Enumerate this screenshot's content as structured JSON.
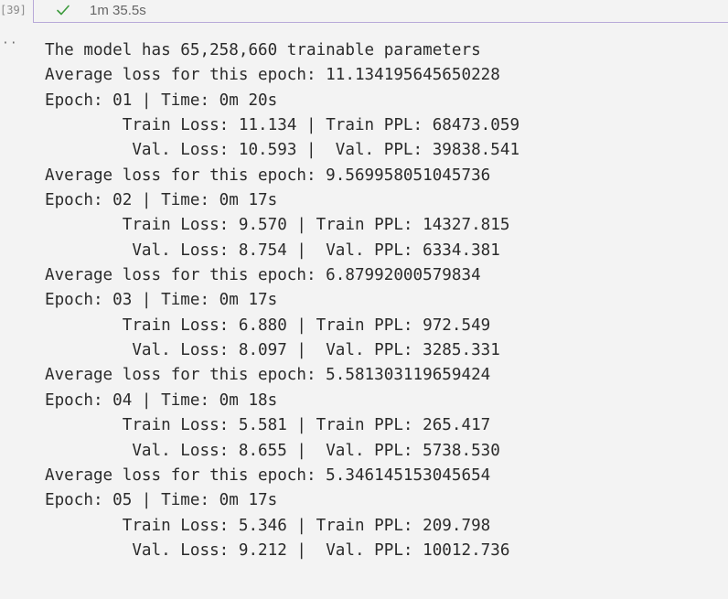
{
  "cell": {
    "execution_count": "[39]",
    "status": "success",
    "duration": "1m 35.5s",
    "output_menu": "··"
  },
  "output": {
    "lines": [
      "The model has 65,258,660 trainable parameters",
      "Average loss for this epoch: 11.134195645650228",
      "Epoch: 01 | Time: 0m 20s",
      "\tTrain Loss: 11.134 | Train PPL: 68473.059",
      "\t Val. Loss: 10.593 |  Val. PPL: 39838.541",
      "Average loss for this epoch: 9.569958051045736",
      "Epoch: 02 | Time: 0m 17s",
      "\tTrain Loss: 9.570 | Train PPL: 14327.815",
      "\t Val. Loss: 8.754 |  Val. PPL: 6334.381",
      "Average loss for this epoch: 6.87992000579834",
      "Epoch: 03 | Time: 0m 17s",
      "\tTrain Loss: 6.880 | Train PPL: 972.549",
      "\t Val. Loss: 8.097 |  Val. PPL: 3285.331",
      "Average loss for this epoch: 5.581303119659424",
      "Epoch: 04 | Time: 0m 18s",
      "\tTrain Loss: 5.581 | Train PPL: 265.417",
      "\t Val. Loss: 8.655 |  Val. PPL: 5738.530",
      "Average loss for this epoch: 5.346145153045654",
      "Epoch: 05 | Time: 0m 17s",
      "\tTrain Loss: 5.346 | Train PPL: 209.798",
      "\t Val. Loss: 9.212 |  Val. PPL: 10012.736"
    ]
  },
  "colors": {
    "success_check": "#3c9a3c",
    "cell_border": "#b8a9d8",
    "background": "#f3f3f3",
    "text": "#2b2b2b"
  }
}
